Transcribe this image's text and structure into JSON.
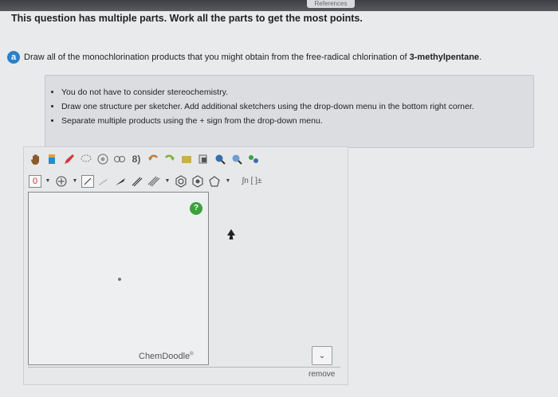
{
  "header": {
    "references_tab": "References"
  },
  "instruction": "This question has multiple parts. Work all the parts to get the most points.",
  "part": {
    "badge": "a",
    "question_prefix": "Draw all of the monochlorination products that you might obtain from the free-radical chlorination of ",
    "question_compound": "3-methylpentane",
    "question_suffix": "."
  },
  "hints": [
    "You do not have to consider stereochemistry.",
    "Draw one structure per sketcher. Add additional sketchers using the drop-down menu in the bottom right corner.",
    "Separate multiple products using the + sign from the drop-down menu."
  ],
  "sketcher": {
    "charge_value": "0",
    "help_label": "?",
    "watermark": "ChemDoodle",
    "watermark_mark": "®",
    "remove_label": "remove",
    "ring_tool_label": "∫n [ ]±"
  },
  "icons": {
    "hand": "hand-icon",
    "eraser": "eraser-icon",
    "lasso": "lasso-icon",
    "plus": "plus-circle-icon",
    "dropdown": "chevron-down-icon"
  }
}
